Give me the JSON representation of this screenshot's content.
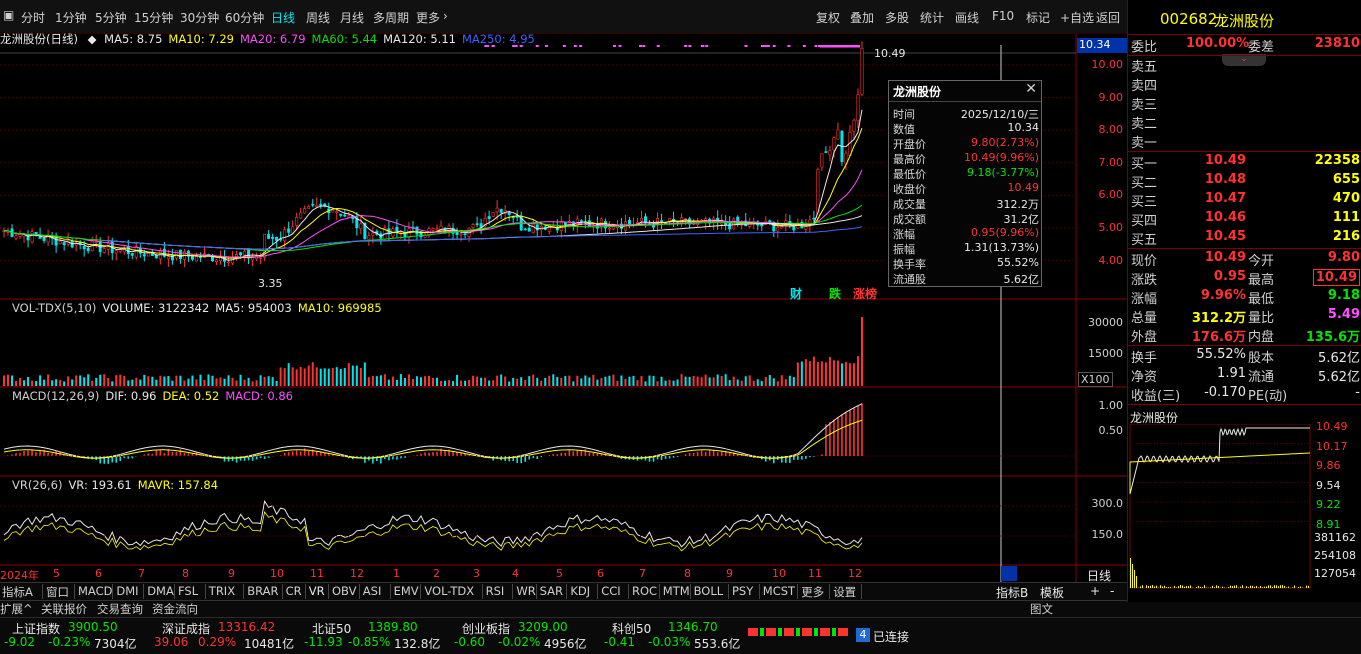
{
  "topbar": {
    "periods": [
      "分时",
      "1分钟",
      "5分钟",
      "15分钟",
      "30分钟",
      "60分钟",
      "日线",
      "周线",
      "月线",
      "多周期",
      "更多"
    ],
    "active_period": "日线",
    "tools": [
      "复权",
      "叠加",
      "多股",
      "统计",
      "画线",
      "F10",
      "标记",
      "+自选",
      "返回"
    ]
  },
  "stock": {
    "code": "002682",
    "name": "龙洲股份"
  },
  "price_chart": {
    "header_name": "龙洲股份(日线)",
    "ma": [
      {
        "label": "MA5: 8.75",
        "color": "#e8e8e8"
      },
      {
        "label": "MA10: 7.29",
        "color": "#ffff00"
      },
      {
        "label": "MA20: 6.79",
        "color": "#ff50ff"
      },
      {
        "label": "MA60: 5.44",
        "color": "#00e600"
      },
      {
        "label": "MA120: 5.11",
        "color": "#e8e8e8"
      },
      {
        "label": "MA250: 4.95",
        "color": "#3c64ff"
      }
    ],
    "y_ticks": [
      "10.00",
      "9.00",
      "8.00",
      "7.00",
      "6.00",
      "5.00",
      "4.00"
    ],
    "current_tag": "10.34",
    "high_label": "10.49",
    "low_label": "3.35",
    "event_tags": [
      {
        "text": "财",
        "color": "#00e5ee"
      },
      {
        "text": "跌",
        "color": "#00e600"
      },
      {
        "text": "涨榜",
        "color": "#ff3232"
      }
    ]
  },
  "popup": {
    "title": "龙洲股份",
    "rows": [
      {
        "k": "时间",
        "v": "2025/12/10/三",
        "c": "#e8e8e8"
      },
      {
        "k": "数值",
        "v": "10.34",
        "c": "#e8e8e8"
      },
      {
        "k": "开盘价",
        "v": "9.80(2.73%)",
        "c": "#ff3232"
      },
      {
        "k": "最高价",
        "v": "10.49(9.96%)",
        "c": "#ff3232"
      },
      {
        "k": "最低价",
        "v": "9.18(-3.77%)",
        "c": "#00e600"
      },
      {
        "k": "收盘价",
        "v": "10.49",
        "c": "#ff3232"
      },
      {
        "k": "成交量",
        "v": "312.2万",
        "c": "#e8e8e8"
      },
      {
        "k": "成交额",
        "v": "31.2亿",
        "c": "#e8e8e8"
      },
      {
        "k": "涨幅",
        "v": "0.95(9.96%)",
        "c": "#ff3232"
      },
      {
        "k": "振幅",
        "v": "1.31(13.73%)",
        "c": "#e8e8e8"
      },
      {
        "k": "换手率",
        "v": "55.52%",
        "c": "#e8e8e8"
      },
      {
        "k": "流通股",
        "v": "5.62亿",
        "c": "#e8e8e8"
      }
    ]
  },
  "vol_chart": {
    "header": [
      {
        "t": "VOL-TDX(5,10)",
        "c": "#d0d0d0"
      },
      {
        "t": "VOLUME: 3122342",
        "c": "#e8e8e8"
      },
      {
        "t": "MA5: 954003",
        "c": "#e8e8e8"
      },
      {
        "t": "MA10: 969985",
        "c": "#ffff00"
      }
    ],
    "y_ticks": [
      "30000",
      "15000"
    ],
    "unit": "X100"
  },
  "macd_chart": {
    "header": [
      {
        "t": "MACD(12,26,9)",
        "c": "#d0d0d0"
      },
      {
        "t": "DIF: 0.96",
        "c": "#e8e8e8"
      },
      {
        "t": "DEA: 0.52",
        "c": "#ffff00"
      },
      {
        "t": "MACD: 0.86",
        "c": "#ff50ff"
      }
    ],
    "y_ticks": [
      "1.00",
      "0.50"
    ]
  },
  "vr_chart": {
    "header": [
      {
        "t": "VR(26,6)",
        "c": "#d0d0d0"
      },
      {
        "t": "VR: 193.61",
        "c": "#e8e8e8"
      },
      {
        "t": "MAVR: 157.84",
        "c": "#ffff00"
      }
    ],
    "y_ticks": [
      "300.0",
      "150.0"
    ]
  },
  "x_axis": {
    "labels": [
      "2024年",
      "5",
      "6",
      "7",
      "8",
      "9",
      "10",
      "11",
      "12",
      "1",
      "2",
      "3",
      "4",
      "5",
      "6",
      "7",
      "8",
      "9",
      "10",
      "11",
      "12"
    ],
    "period": "日线"
  },
  "indicator_tabs": [
    "指标A",
    "窗口",
    "MACD",
    "DMI",
    "DMA",
    "FSL",
    "TRIX",
    "BRAR",
    "CR",
    "VR",
    "OBV",
    "ASI",
    "EMV",
    "VOL-TDX",
    "RSI",
    "WR",
    "SAR",
    "KDJ",
    "CCI",
    "ROC",
    "MTM",
    "BOLL",
    "PSY",
    "MCST",
    "更多",
    "设置"
  ],
  "indicator_right": [
    "指标B",
    "模板",
    "+",
    "-"
  ],
  "bottom_tabs": [
    "扩展^",
    "关联报价",
    "交易查询",
    "资金流向"
  ],
  "orderbook": {
    "weibi_label": "委比",
    "weibi": "100.00%",
    "weicha_label": "委差",
    "weicha": "23810",
    "sells": [
      {
        "label": "卖五"
      },
      {
        "label": "卖四"
      },
      {
        "label": "卖三"
      },
      {
        "label": "卖二"
      },
      {
        "label": "卖一"
      }
    ],
    "buys": [
      {
        "label": "买一",
        "price": "10.49",
        "vol": "22358"
      },
      {
        "label": "买二",
        "price": "10.48",
        "vol": "655"
      },
      {
        "label": "买三",
        "price": "10.47",
        "vol": "470"
      },
      {
        "label": "买四",
        "price": "10.46",
        "vol": "111"
      },
      {
        "label": "买五",
        "price": "10.45",
        "vol": "216"
      }
    ]
  },
  "quote": [
    {
      "l1": "现价",
      "v1": "10.49",
      "c1": "#ff3232",
      "l2": "今开",
      "v2": "9.80",
      "c2": "#ff3232"
    },
    {
      "l1": "涨跌",
      "v1": "0.95",
      "c1": "#ff3232",
      "l2": "最高",
      "v2": "10.49",
      "c2": "#ff3232"
    },
    {
      "l1": "涨幅",
      "v1": "9.96%",
      "c1": "#ff3232",
      "l2": "最低",
      "v2": "9.18",
      "c2": "#00e600"
    },
    {
      "l1": "总量",
      "v1": "312.2万",
      "c1": "#ffff00",
      "l2": "量比",
      "v2": "5.49",
      "c2": "#ff50ff"
    },
    {
      "l1": "外盘",
      "v1": "176.6万",
      "c1": "#ff3232",
      "l2": "内盘",
      "v2": "135.6万",
      "c2": "#00e600"
    }
  ],
  "fundamentals": [
    {
      "l1": "换手",
      "v1": "55.52%",
      "l2": "股本",
      "v2": "5.62亿"
    },
    {
      "l1": "净资",
      "v1": "1.91",
      "l2": "流通",
      "v2": "5.62亿"
    },
    {
      "l1": "收益(三)",
      "v1": "-0.170",
      "l2": "PE(动)",
      "v2": "-"
    }
  ],
  "mini_chart": {
    "title": "龙洲股份",
    "price_ticks": [
      "10.49",
      "10.17",
      "9.86",
      "9.54",
      "9.22",
      "8.91"
    ],
    "vol_ticks": [
      "381162",
      "254108",
      "127054"
    ]
  },
  "statusbar": {
    "indices": [
      {
        "name": "上证指数",
        "price": "3900.50",
        "chg": "-9.02",
        "pct": "-0.23%",
        "amt": "7304亿",
        "c": "#00e600"
      },
      {
        "name": "深证成指",
        "price": "13316.42",
        "chg": "39.06",
        "pct": "0.29%",
        "amt": "10481亿",
        "c": "#ff3232"
      },
      {
        "name": "北证50",
        "price": "1389.80",
        "chg": "-11.93",
        "pct": "-0.85%",
        "amt": "132.8亿",
        "c": "#00e600"
      },
      {
        "name": "创业板指",
        "price": "3209.00",
        "chg": "-0.60",
        "pct": "-0.02%",
        "amt": "4956亿",
        "c": "#00e600"
      },
      {
        "name": "科创50",
        "price": "1346.70",
        "chg": "-0.41",
        "pct": "-0.03%",
        "amt": "553.6亿",
        "c": "#00e600"
      }
    ],
    "conn_num": "4",
    "conn_text": "已连接",
    "right_tab": "图文"
  }
}
